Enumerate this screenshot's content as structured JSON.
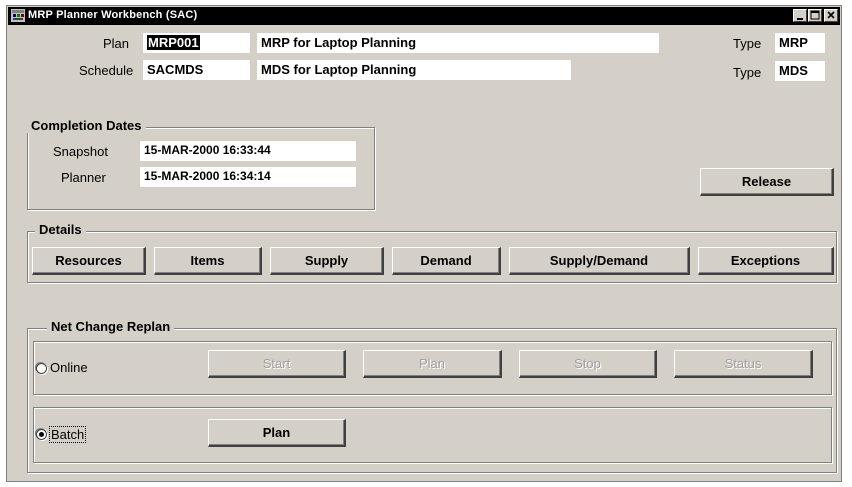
{
  "window": {
    "title": "MRP Planner Workbench (SAC)"
  },
  "header": {
    "plan_label": "Plan",
    "plan_value": "MRP001",
    "plan_desc": "MRP for Laptop Planning",
    "plan_type_label": "Type",
    "plan_type_value": "MRP",
    "schedule_label": "Schedule",
    "schedule_value": "SACMDS",
    "schedule_desc": "MDS for Laptop Planning",
    "schedule_type_label": "Type",
    "schedule_type_value": "MDS"
  },
  "completion": {
    "title": "Completion Dates",
    "snapshot_label": "Snapshot",
    "snapshot_value": "15-MAR-2000 16:33:44",
    "planner_label": "Planner",
    "planner_value": "15-MAR-2000 16:34:14"
  },
  "release_label": "Release",
  "details": {
    "title": "Details",
    "buttons": [
      "Resources",
      "Items",
      "Supply",
      "Demand",
      "Supply/Demand",
      "Exceptions"
    ]
  },
  "replan": {
    "title": "Net Change Replan",
    "online": {
      "label": "Online",
      "selected": false,
      "buttons": [
        "Start",
        "Plan",
        "Stop",
        "Status"
      ]
    },
    "batch": {
      "label": "Batch",
      "selected": true,
      "plan_label": "Plan"
    }
  }
}
